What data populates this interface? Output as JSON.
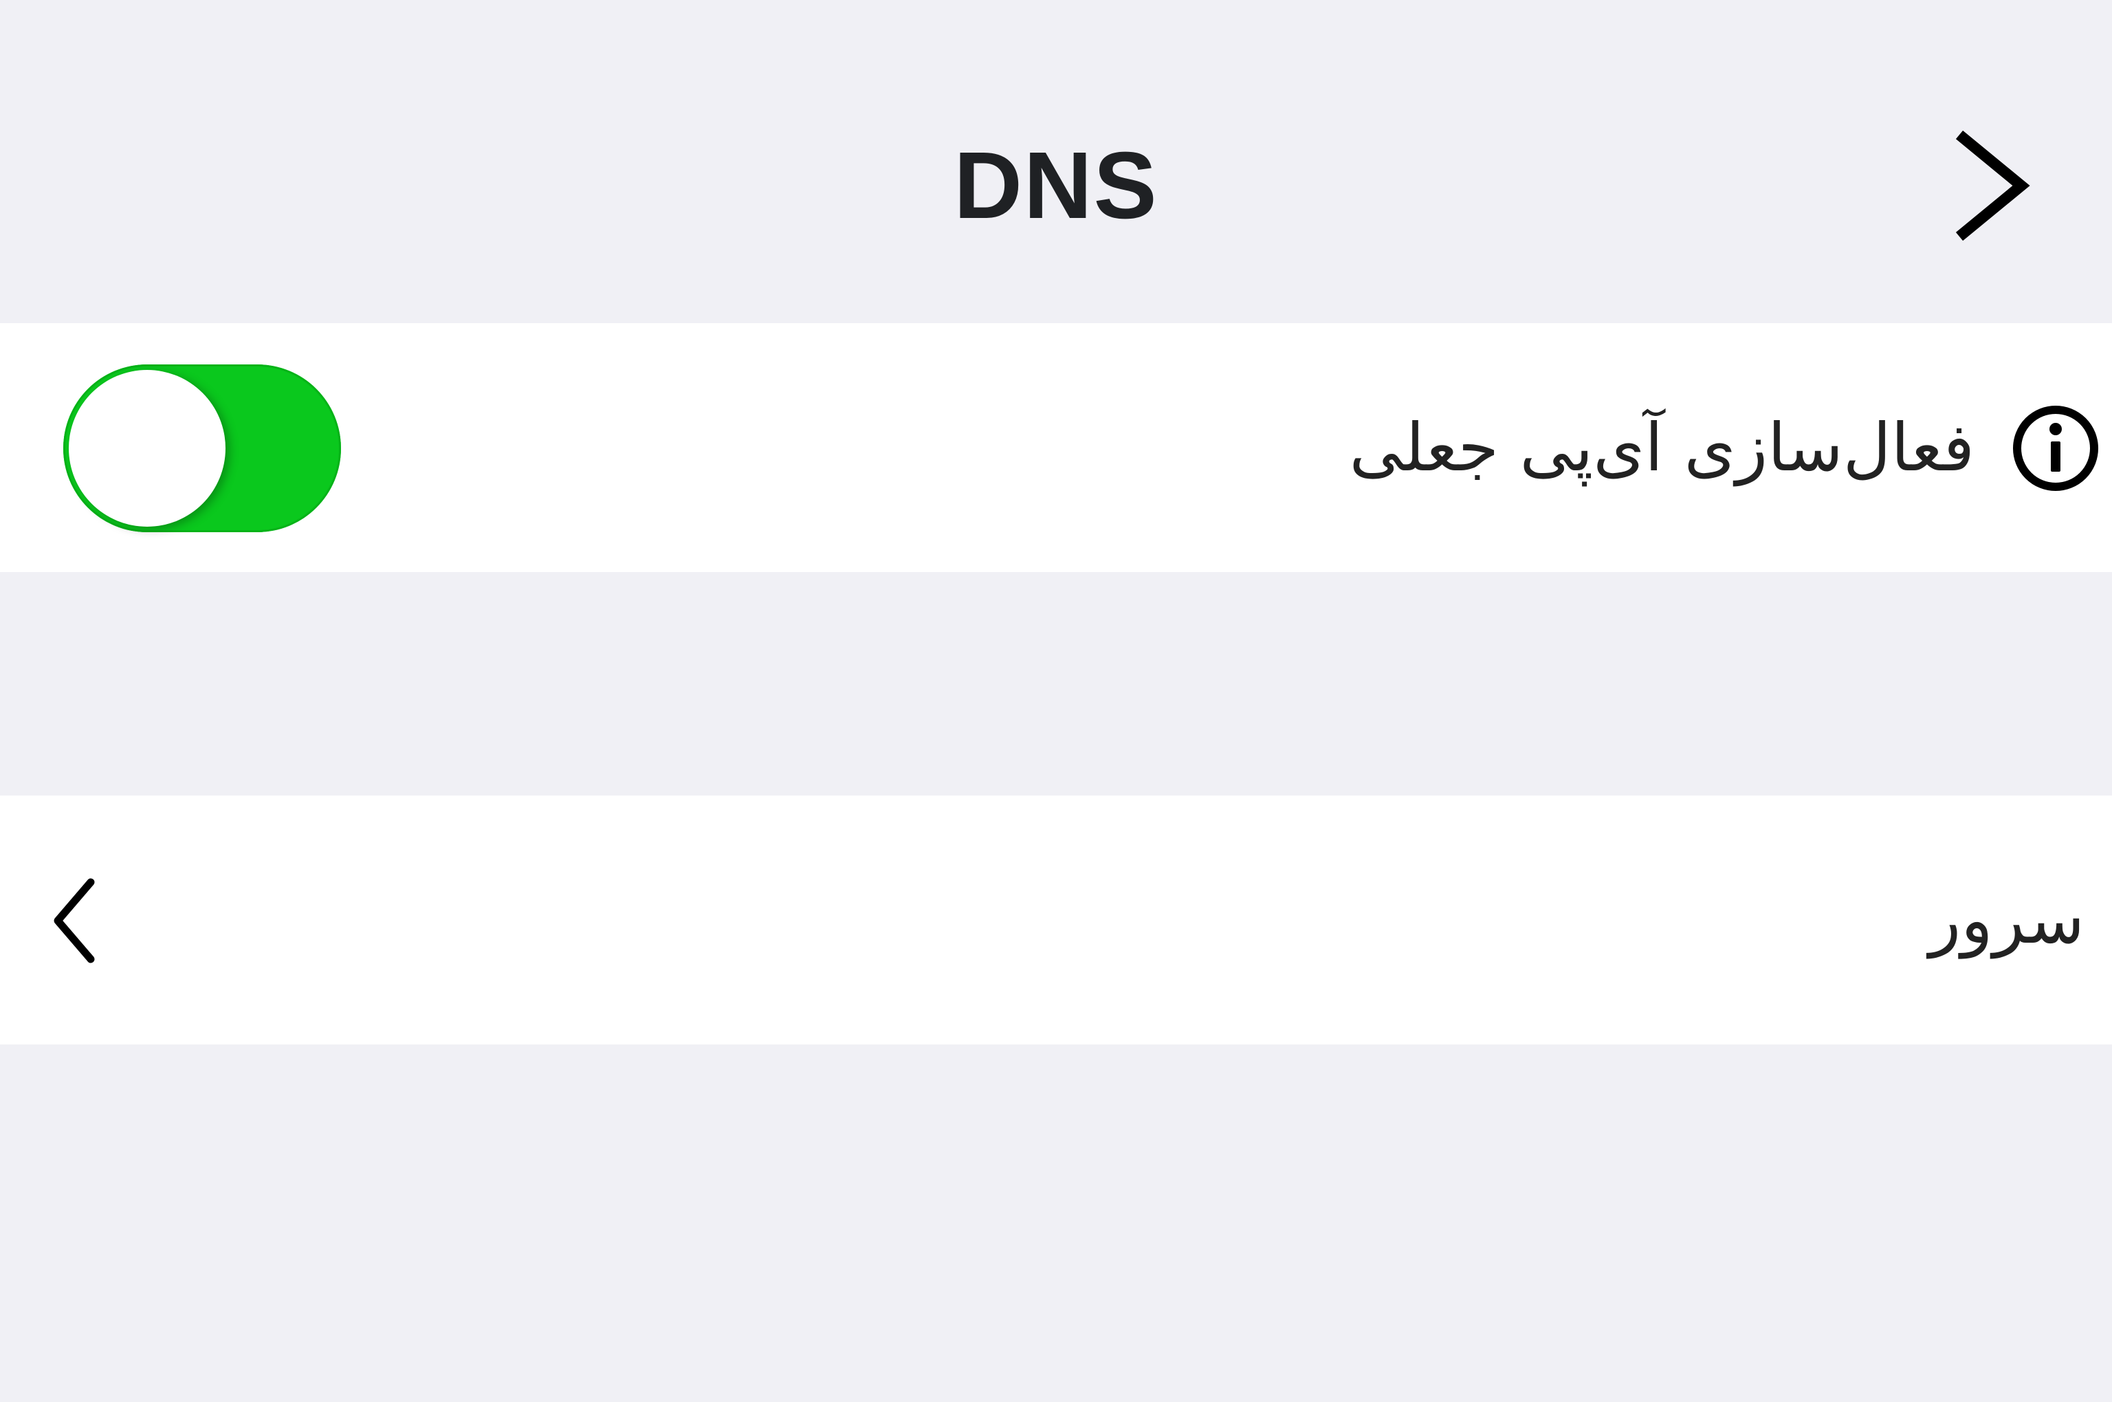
{
  "nav": {
    "title": "DNS",
    "back_icon": "chevron-right-icon"
  },
  "settings": {
    "fake_ip_toggle": {
      "label": "فعال‌سازی آی‌پی جعلی",
      "info_icon": "info-icon",
      "state": "on",
      "on_color": "#0ac81d"
    },
    "server_row": {
      "label": "سرور",
      "chevron_icon": "chevron-left-icon"
    }
  },
  "colors": {
    "background": "#f0f0f5",
    "row_background": "#ffffff",
    "title_color": "#1f2124"
  }
}
